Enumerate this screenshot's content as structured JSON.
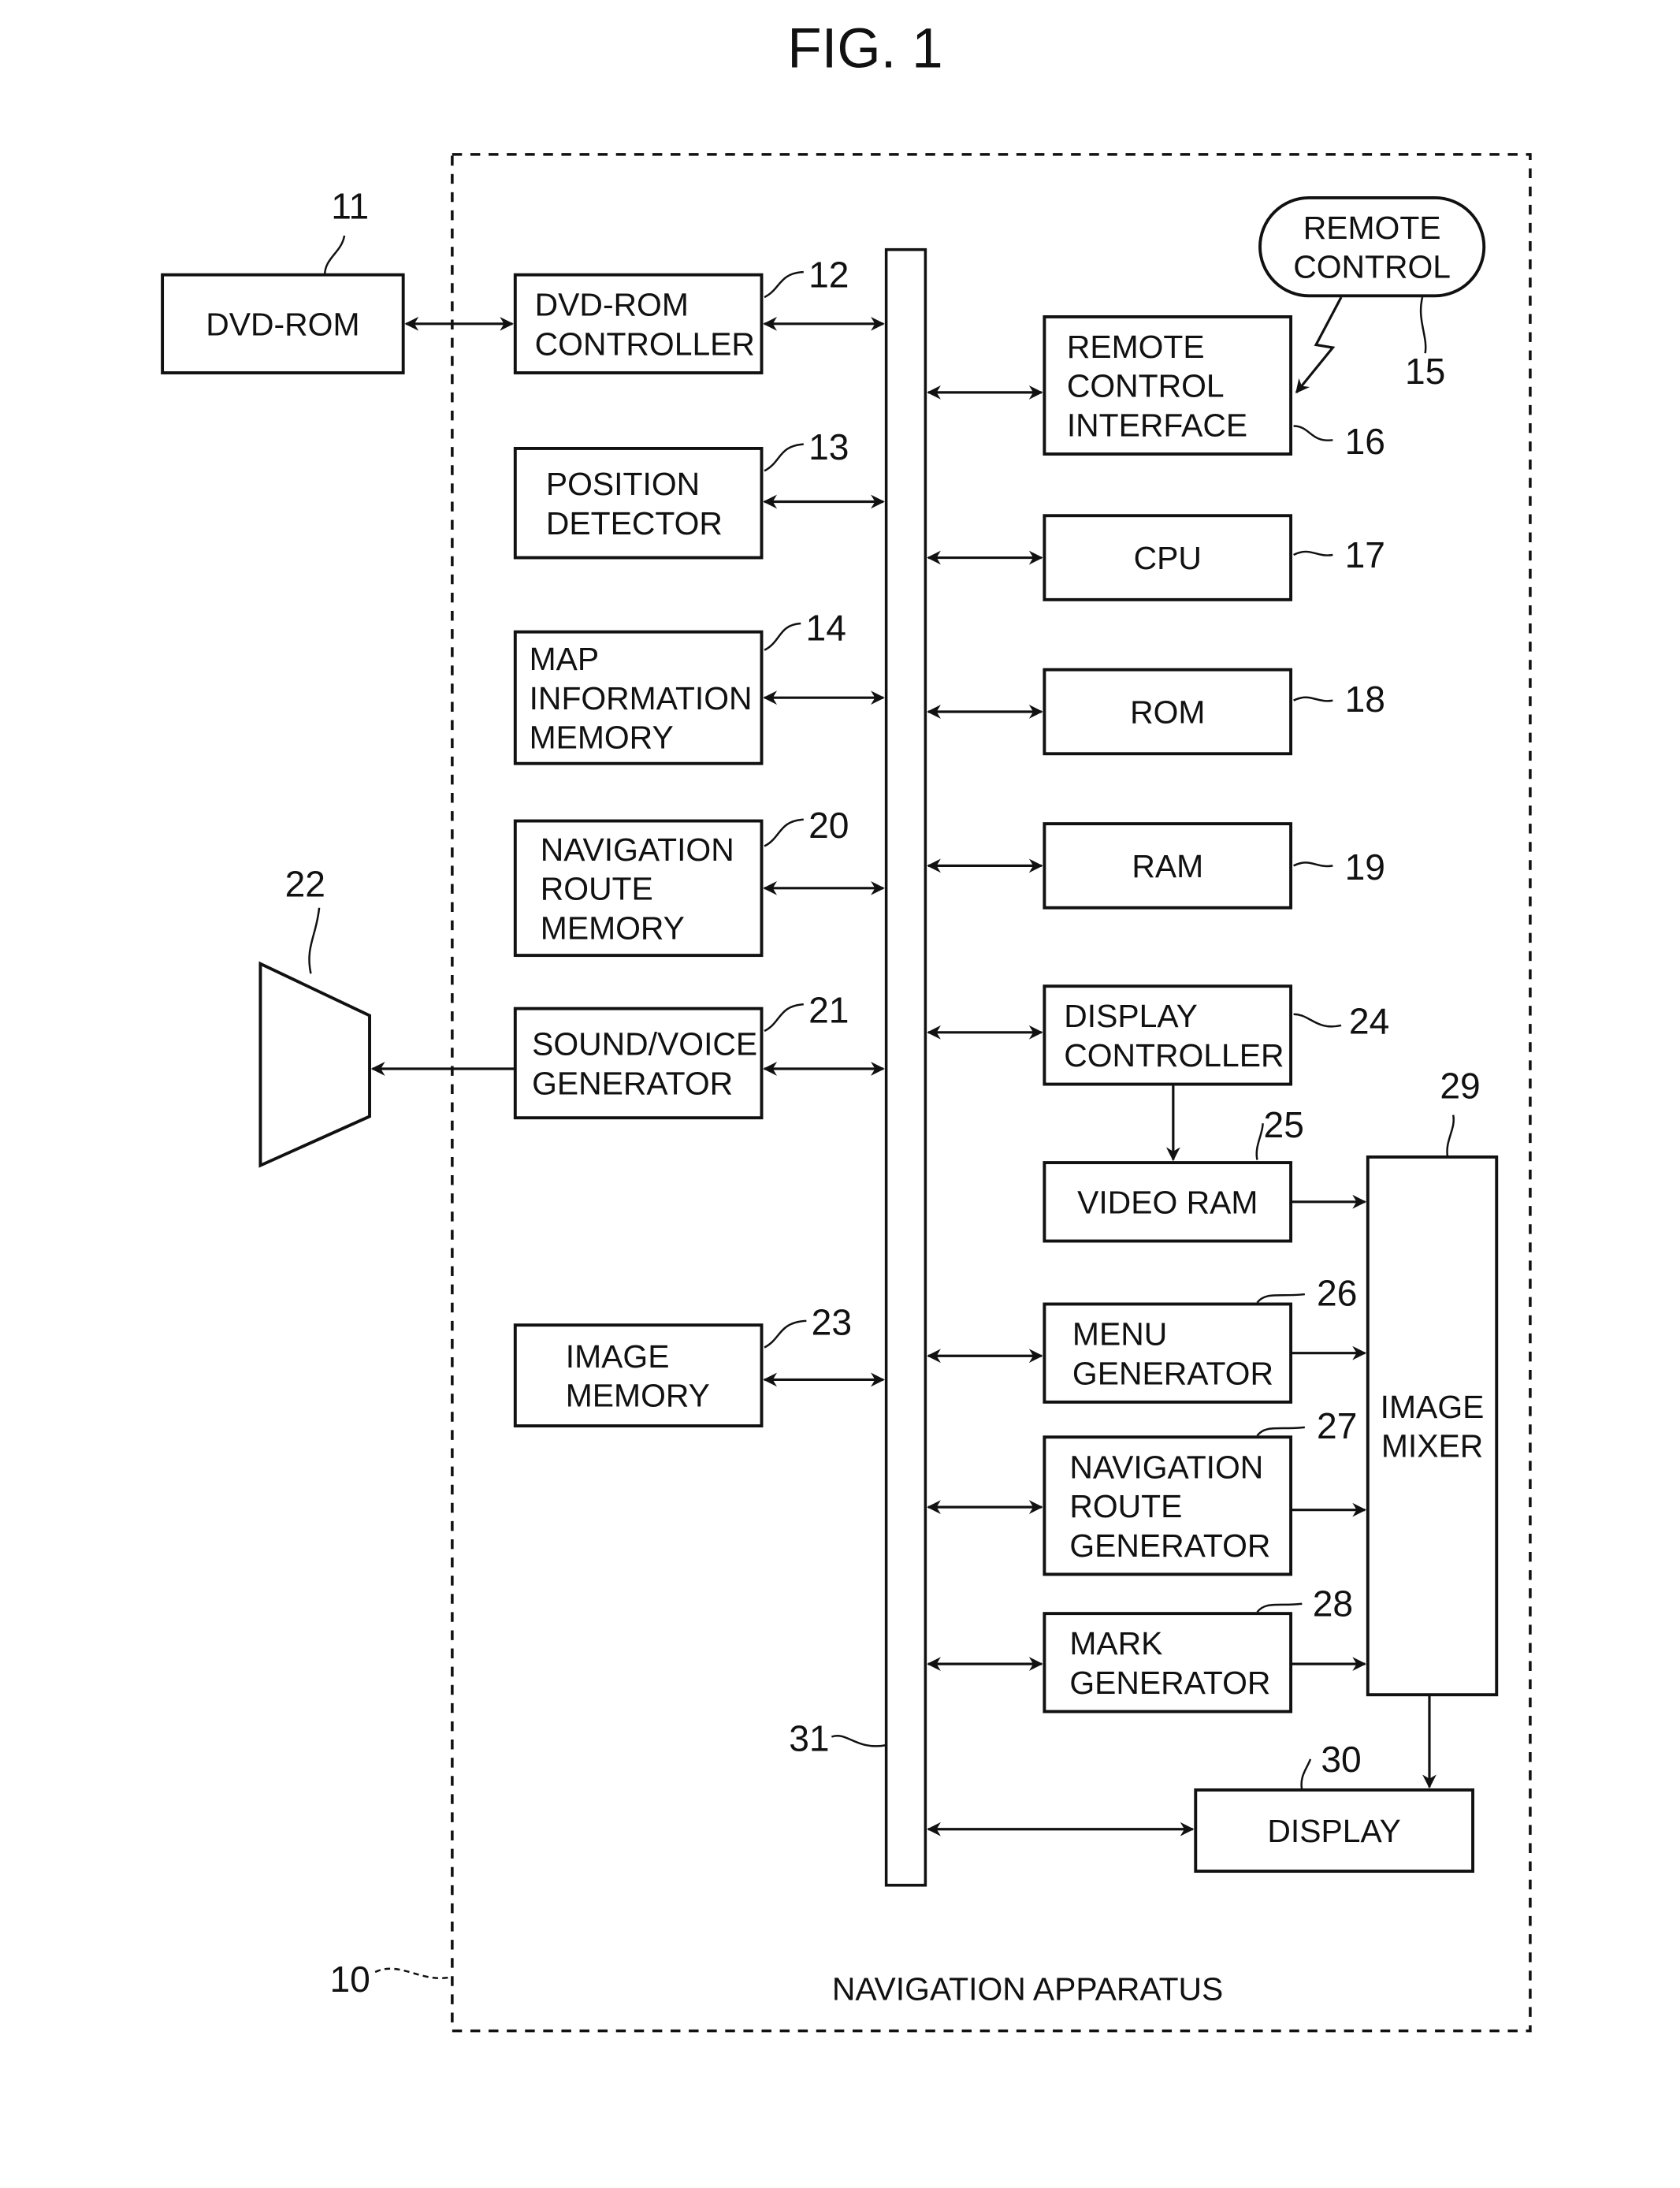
{
  "figure": {
    "title": "FIG. 1",
    "apparatus_label": "NAVIGATION APPARATUS",
    "apparatus_ref": "10",
    "bus_ref": "31"
  },
  "blocks": [
    {
      "id": "dvd-rom",
      "ref": "11",
      "lines": [
        "DVD-ROM"
      ]
    },
    {
      "id": "dvd-rom-controller",
      "ref": "12",
      "lines": [
        "DVD-ROM",
        "CONTROLLER"
      ]
    },
    {
      "id": "position-detector",
      "ref": "13",
      "lines": [
        "POSITION",
        "DETECTOR"
      ]
    },
    {
      "id": "map-information-memory",
      "ref": "14",
      "lines": [
        "MAP",
        "INFORMATION",
        "MEMORY"
      ]
    },
    {
      "id": "remote-control",
      "ref": "15",
      "lines": [
        "REMOTE",
        "CONTROL"
      ]
    },
    {
      "id": "remote-control-interface",
      "ref": "16",
      "lines": [
        "REMOTE",
        "CONTROL",
        "INTERFACE"
      ]
    },
    {
      "id": "cpu",
      "ref": "17",
      "lines": [
        "CPU"
      ]
    },
    {
      "id": "rom",
      "ref": "18",
      "lines": [
        "ROM"
      ]
    },
    {
      "id": "ram",
      "ref": "19",
      "lines": [
        "RAM"
      ]
    },
    {
      "id": "navigation-route-memory",
      "ref": "20",
      "lines": [
        "NAVIGATION",
        "ROUTE",
        "MEMORY"
      ]
    },
    {
      "id": "sound-voice-generator",
      "ref": "21",
      "lines": [
        "SOUND/VOICE",
        "GENERATOR"
      ]
    },
    {
      "id": "speaker",
      "ref": "22",
      "lines": []
    },
    {
      "id": "image-memory",
      "ref": "23",
      "lines": [
        "IMAGE",
        "MEMORY"
      ]
    },
    {
      "id": "display-controller",
      "ref": "24",
      "lines": [
        "DISPLAY",
        "CONTROLLER"
      ]
    },
    {
      "id": "video-ram",
      "ref": "25",
      "lines": [
        "VIDEO RAM"
      ]
    },
    {
      "id": "menu-generator",
      "ref": "26",
      "lines": [
        "MENU",
        "GENERATOR"
      ]
    },
    {
      "id": "navigation-route-generator",
      "ref": "27",
      "lines": [
        "NAVIGATION",
        "ROUTE",
        "GENERATOR"
      ]
    },
    {
      "id": "mark-generator",
      "ref": "28",
      "lines": [
        "MARK",
        "GENERATOR"
      ]
    },
    {
      "id": "image-mixer",
      "ref": "29",
      "lines": [
        "IMAGE",
        "MIXER"
      ]
    },
    {
      "id": "display",
      "ref": "30",
      "lines": [
        "DISPLAY"
      ]
    }
  ]
}
